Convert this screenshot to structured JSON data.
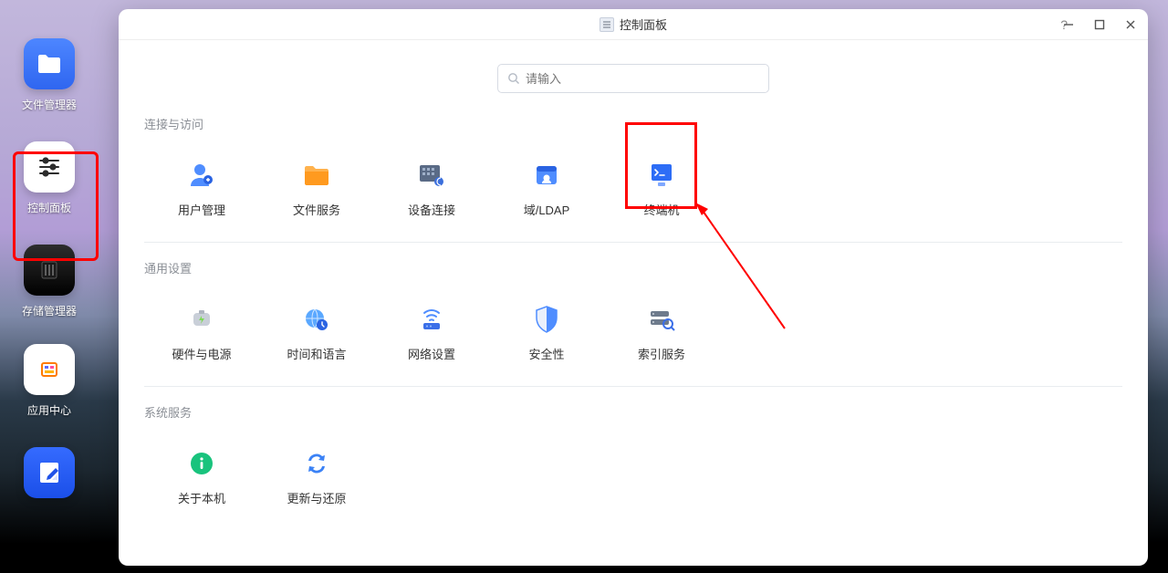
{
  "window": {
    "title": "控制面板",
    "search_placeholder": "请输入",
    "help_label": "?"
  },
  "dock": {
    "items": [
      {
        "name": "file-manager",
        "label": "文件管理器"
      },
      {
        "name": "control-panel",
        "label": "控制面板"
      },
      {
        "name": "storage-manager",
        "label": "存储管理器"
      },
      {
        "name": "app-center",
        "label": "应用中心"
      },
      {
        "name": "notes",
        "label": ""
      }
    ]
  },
  "sections": [
    {
      "title": "连接与访问",
      "items": [
        {
          "name": "user-management",
          "label": "用户管理"
        },
        {
          "name": "file-services",
          "label": "文件服务"
        },
        {
          "name": "device-connect",
          "label": "设备连接"
        },
        {
          "name": "domain-ldap",
          "label": "域/LDAP"
        },
        {
          "name": "terminal",
          "label": "终端机"
        }
      ]
    },
    {
      "title": "通用设置",
      "items": [
        {
          "name": "hardware-power",
          "label": "硬件与电源"
        },
        {
          "name": "time-language",
          "label": "时间和语言"
        },
        {
          "name": "network-settings",
          "label": "网络设置"
        },
        {
          "name": "security",
          "label": "安全性"
        },
        {
          "name": "index-service",
          "label": "索引服务"
        }
      ]
    },
    {
      "title": "系统服务",
      "items": [
        {
          "name": "about",
          "label": "关于本机"
        },
        {
          "name": "update-restore",
          "label": "更新与还原"
        }
      ]
    }
  ]
}
